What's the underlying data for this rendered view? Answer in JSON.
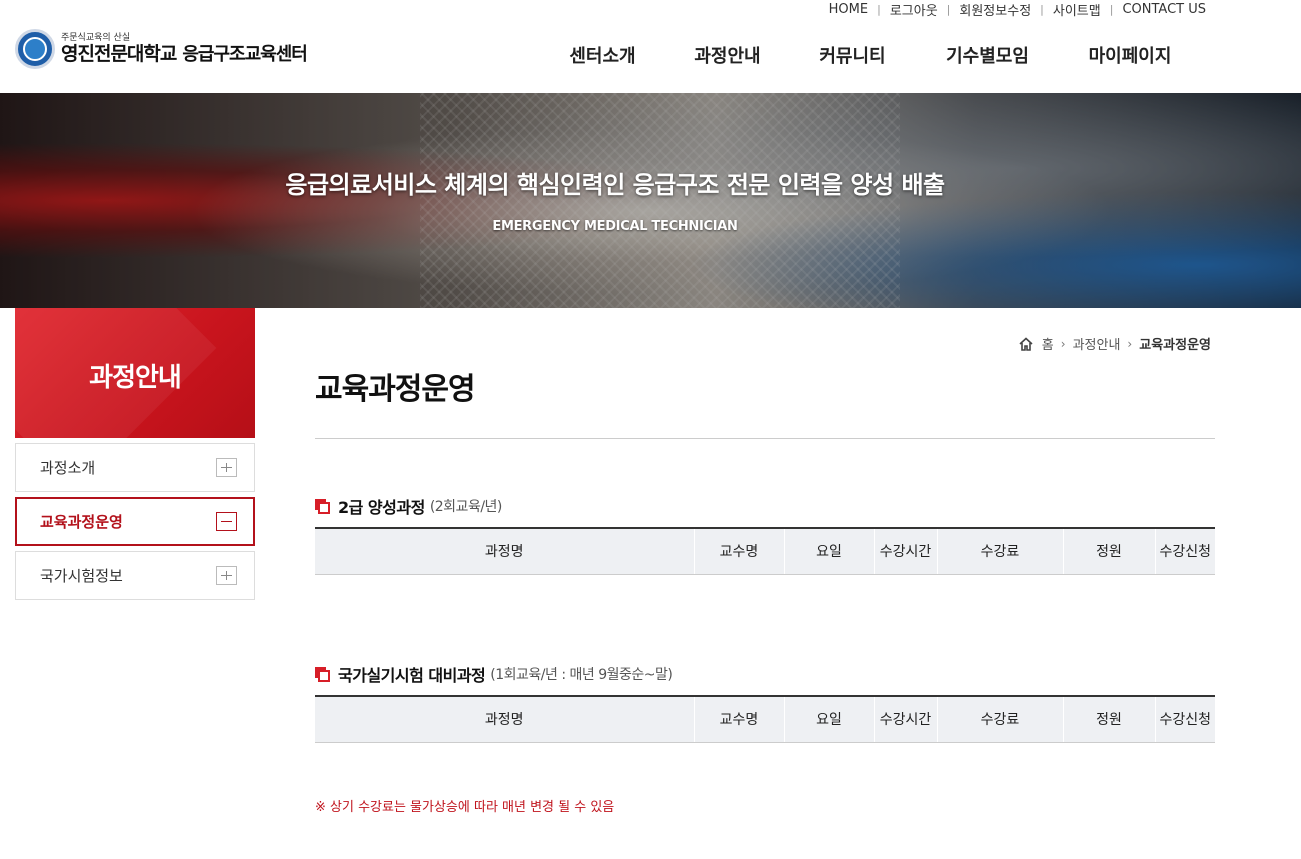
{
  "utility_links": [
    "HOME",
    "로그아웃",
    "회원정보수정",
    "사이트맵",
    "CONTACT US"
  ],
  "logo": {
    "slogan": "주문식교육의 산실",
    "college": "영진전문대학교",
    "center": "응급구조교육센터"
  },
  "gnb": [
    "센터소개",
    "과정안내",
    "커뮤니티",
    "기수별모임",
    "마이페이지"
  ],
  "banner": {
    "headline": "응급의료서비스 체계의 핵심인력인 응급구조 전문 인력을 양성 배출",
    "sub": "EMERGENCY MEDICAL TECHNICIAN"
  },
  "lnb": {
    "title": "과정안내",
    "items": [
      {
        "label": "과정소개",
        "active": false
      },
      {
        "label": "교육과정운영",
        "active": true
      },
      {
        "label": "국가시험정보",
        "active": false
      }
    ]
  },
  "breadcrumb": {
    "home": "홈",
    "parent": "과정안내",
    "current": "교육과정운영"
  },
  "page_title": "교육과정운영",
  "sections": [
    {
      "title": "2급 양성과정",
      "note": "(2회교육/년)"
    },
    {
      "title": "국가실기시험 대비과정",
      "note": "(1회교육/년 : 매년 9월중순~말)"
    }
  ],
  "table_headers": [
    "과정명",
    "교수명",
    "요일",
    "수강시간",
    "수강료",
    "정원",
    "수강신청"
  ],
  "notice": "※ 상기 수강료는 물가상승에 따라 매년 변경 될 수 있음",
  "colors": {
    "accent": "#c8141d",
    "table_header_bg": "#eef0f3"
  }
}
